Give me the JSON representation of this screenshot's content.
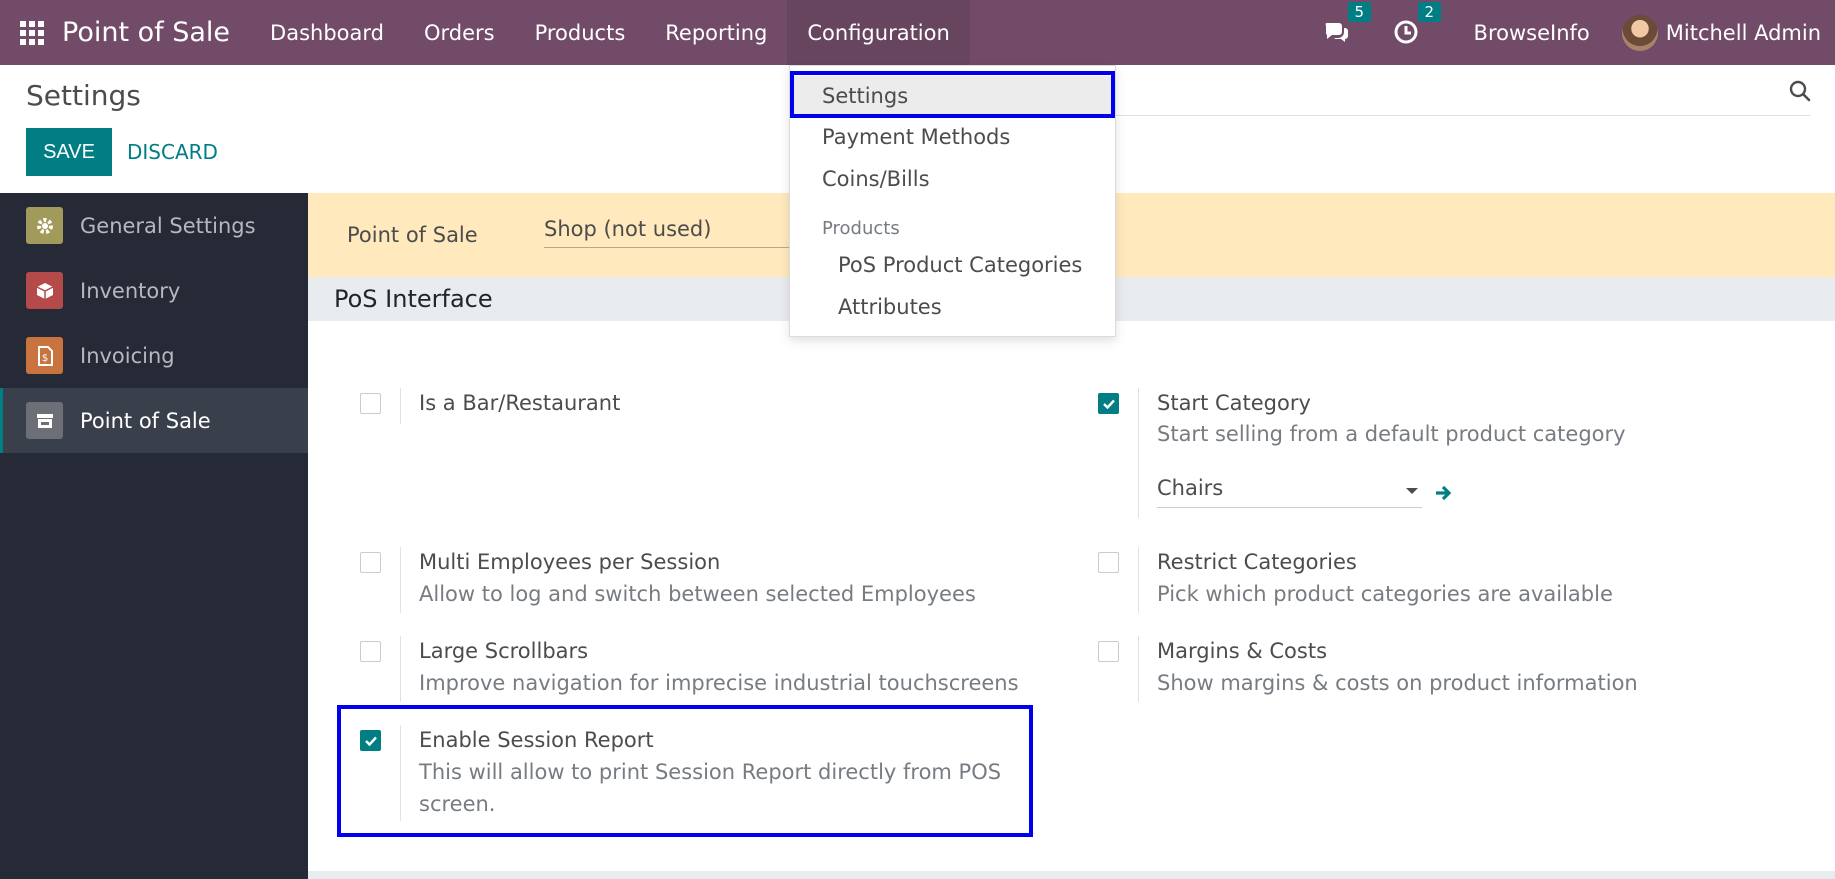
{
  "navbar": {
    "brand": "Point of Sale",
    "menu": [
      "Dashboard",
      "Orders",
      "Products",
      "Reporting",
      "Configuration"
    ],
    "messages_badge": "5",
    "activities_badge": "2",
    "company": "BrowseInfo",
    "user": "Mitchell Admin"
  },
  "control": {
    "title": "Settings",
    "save_label": "SAVE",
    "discard_label": "DISCARD"
  },
  "sidebar": {
    "items": [
      {
        "label": "General Settings",
        "icon": "gear-icon",
        "color": "#a29a5a"
      },
      {
        "label": "Inventory",
        "icon": "box-icon",
        "color": "#b54a4a"
      },
      {
        "label": "Invoicing",
        "icon": "invoice-icon",
        "color": "#c9733f"
      },
      {
        "label": "Point of Sale",
        "icon": "store-icon",
        "color": "#6c6f76"
      }
    ]
  },
  "banner": {
    "label": "Point of Sale",
    "value": "Shop (not used)"
  },
  "section": {
    "title": "PoS Interface"
  },
  "settings": {
    "bar_restaurant": {
      "title": "Is a Bar/Restaurant",
      "checked": false
    },
    "start_category": {
      "title": "Start Category",
      "desc": "Start selling from a default product category",
      "checked": true,
      "value": "Chairs"
    },
    "multi_employees": {
      "title": "Multi Employees per Session",
      "desc": "Allow to log and switch between selected Employees",
      "checked": false
    },
    "restrict_categories": {
      "title": "Restrict Categories",
      "desc": "Pick which product categories are available",
      "checked": false
    },
    "large_scrollbars": {
      "title": "Large Scrollbars",
      "desc": "Improve navigation for imprecise industrial touchscreens",
      "checked": false
    },
    "margins_costs": {
      "title": "Margins & Costs",
      "desc": "Show margins & costs on product information",
      "checked": false
    },
    "session_report": {
      "title": "Enable Session Report",
      "desc": "This will allow to print Session Report directly from POS screen.",
      "checked": true
    }
  },
  "dropdown": {
    "settings": "Settings",
    "payment_methods": "Payment Methods",
    "coins_bills": "Coins/Bills",
    "products_header": "Products",
    "pos_product_categories": "PoS Product Categories",
    "attributes": "Attributes"
  },
  "colors": {
    "navbar": "#714b67",
    "accent": "#017e84",
    "highlight": "#0000ee"
  }
}
